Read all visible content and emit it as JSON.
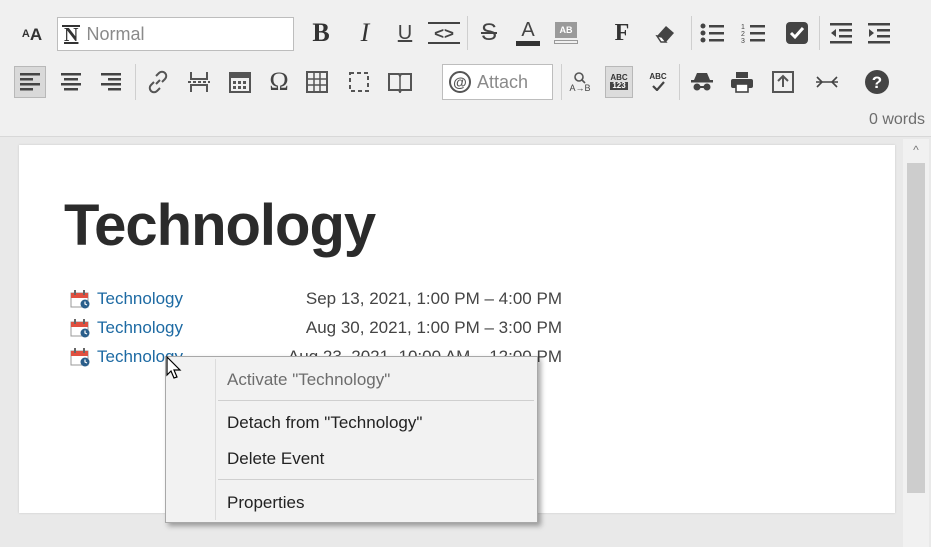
{
  "toolbar": {
    "style_value": "Normal",
    "attach_label": "Attach",
    "word_count": "0 words"
  },
  "document": {
    "heading": "Technology",
    "events": [
      {
        "title": "Technology",
        "time": "Sep 13, 2021, 1:00 PM – 4:00 PM"
      },
      {
        "title": "Technology",
        "time": "Aug 30, 2021, 1:00 PM – 3:00 PM"
      },
      {
        "title": "Technology",
        "time": "Aug 23, 2021, 10:00 AM – 12:00 PM"
      }
    ]
  },
  "context_menu": {
    "activate": "Activate \"Technology\"",
    "detach": "Detach from \"Technology\"",
    "delete": "Delete Event",
    "properties": "Properties"
  },
  "colors": {
    "link": "#1d6aa3",
    "toolbar_bg": "#f0f0f0",
    "menu_bg": "#f2f2f2"
  }
}
